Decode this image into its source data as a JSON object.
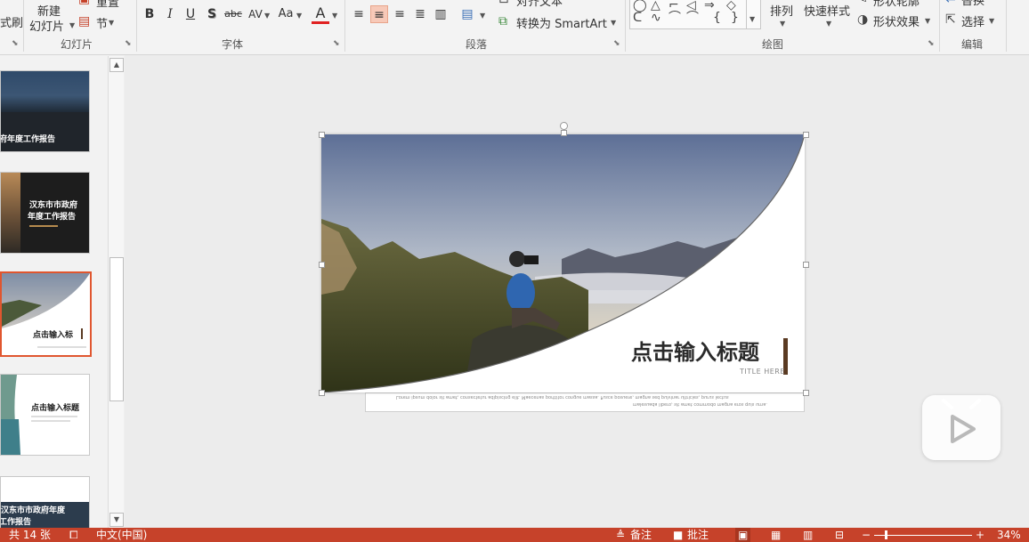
{
  "ribbon": {
    "clipboard": {
      "brush_label": "式刷"
    },
    "slides_group": {
      "new_slide_line1": "新建",
      "new_slide_line2": "幻灯片",
      "reset_label": "重置",
      "section_label": "节",
      "group_label": "幻灯片"
    },
    "font_group": {
      "bold": "B",
      "italic": "I",
      "underline": "U",
      "shadow": "S",
      "strike": "abc",
      "spacing": "AV",
      "case": "Aa",
      "color": "A",
      "group_label": "字体"
    },
    "paragraph_group": {
      "align_text_label": "对齐文本",
      "smartart_label": "转换为 SmartArt",
      "group_label": "段落"
    },
    "drawing_group": {
      "shape_glyphs": [
        "◯",
        "△",
        "⌐",
        "◁",
        "⇒",
        "◇",
        "ᑕ",
        "∿",
        "⌒",
        "⌒",
        "{",
        "}"
      ],
      "arrange_label": "排列",
      "quick_styles_label": "快速样式",
      "shape_outline_label": "形状轮廓",
      "shape_effects_label": "形状效果",
      "group_label": "绘图"
    },
    "editing_group": {
      "replace_label": "替换",
      "select_label": "选择",
      "group_label": "编辑"
    }
  },
  "thumbnails": [
    {
      "title": "府年度工作报告"
    },
    {
      "title_line1": "汉东市市政府",
      "title_line2": "年度工作报告"
    },
    {
      "title": "点击输入标"
    },
    {
      "title": "点击输入标题"
    },
    {
      "title_line1": "汉东市市政府年度",
      "title_line2": "工作报告"
    }
  ],
  "slide": {
    "title": "点击输入标题",
    "subtitle": "TITLE HERE",
    "body_line1": "Lorem ipsum dolor sit amet, consectetur adipiscing elit. Maecenas porttitor congue massa. Fusce posuere, magna sed pulvinar ultricies, purus lectus",
    "body_line2": "malesuada libero, sit amet commodo magna eros quis urna."
  },
  "status": {
    "slide_count": "共 14 张",
    "language": "中文(中国)",
    "notes": "备注",
    "comments": "批注",
    "zoom": "34%"
  },
  "colors": {
    "accent": "#c6422a",
    "selection": "#e0562f",
    "slide_title_bar": "#5a3a22"
  }
}
